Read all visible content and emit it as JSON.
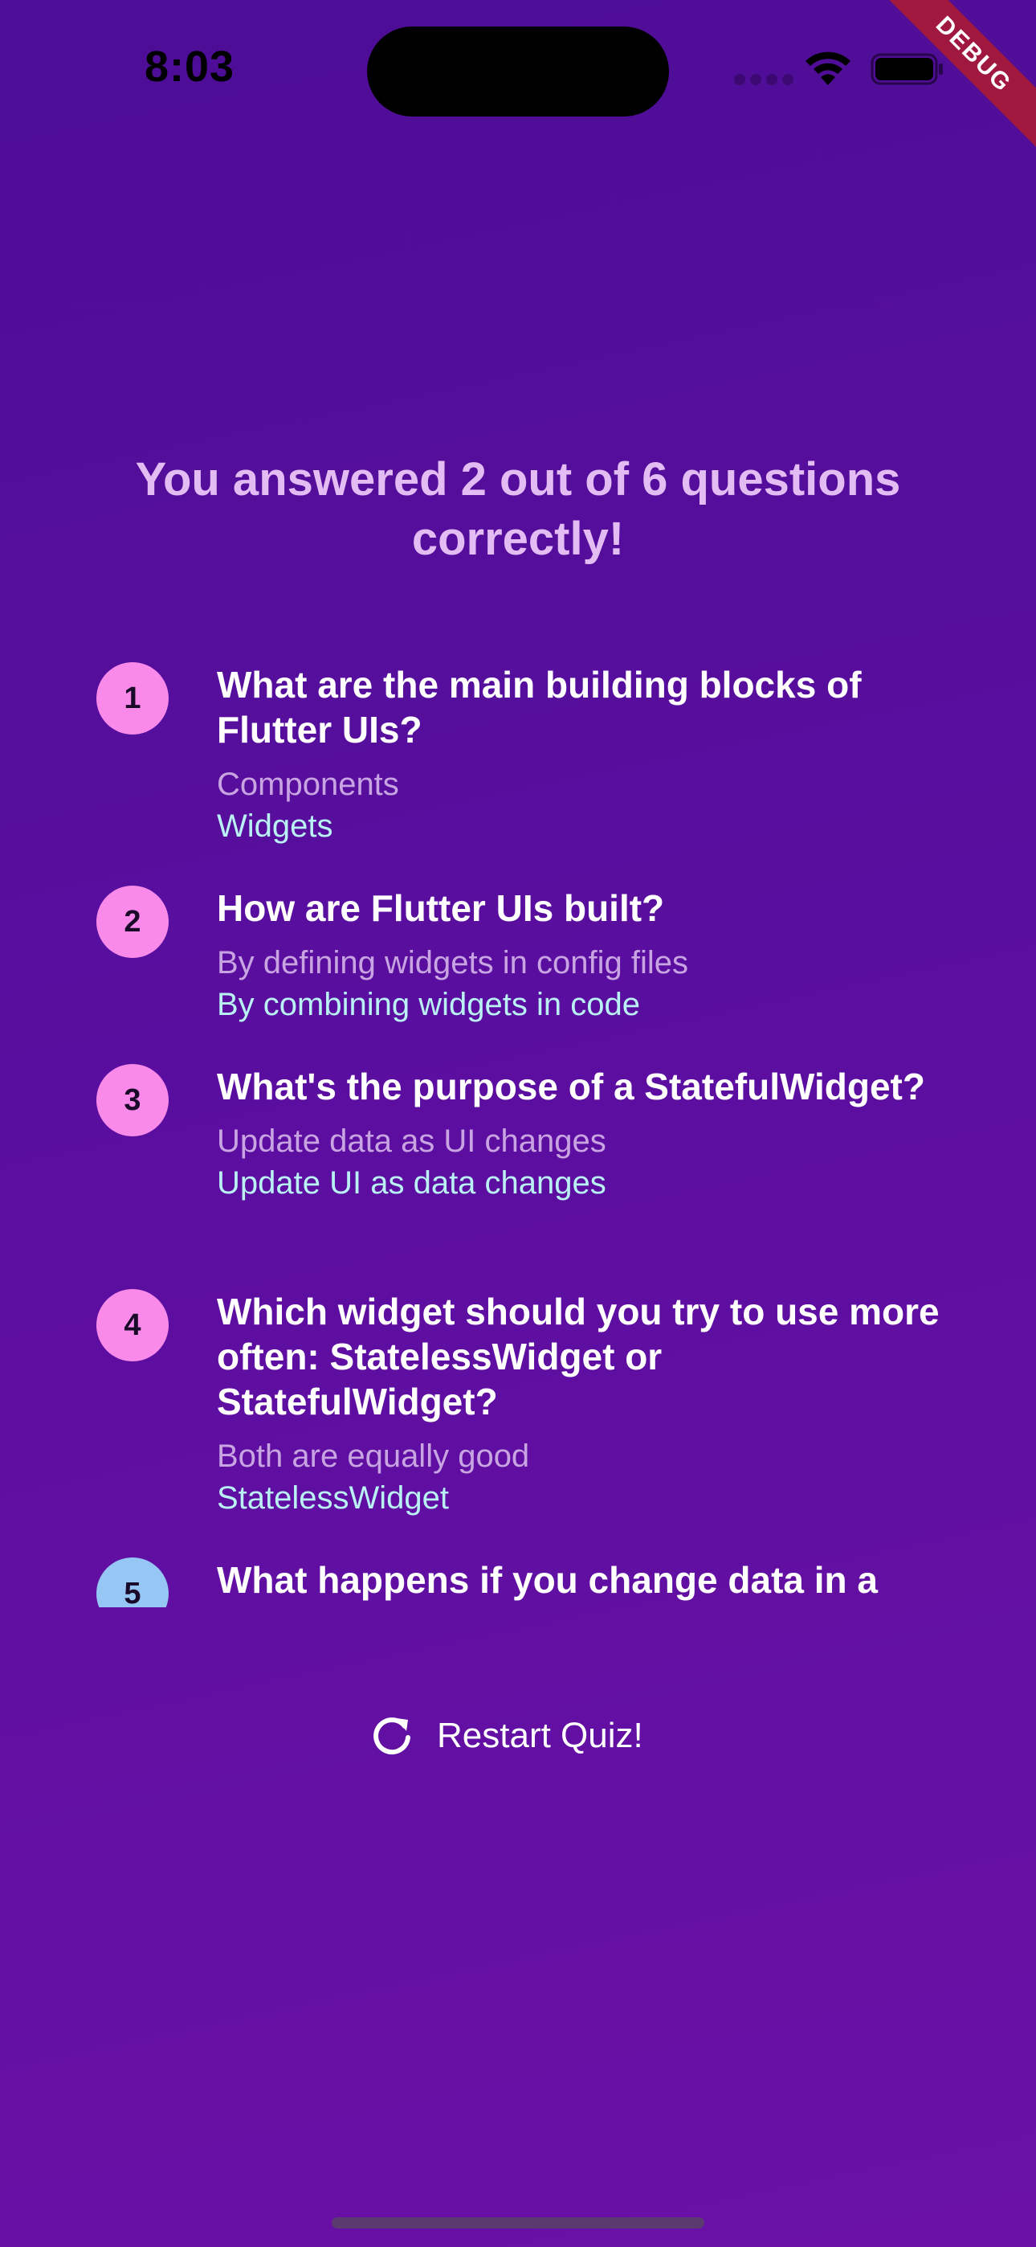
{
  "status_bar": {
    "time": "8:03",
    "icons": [
      "cellular-icon",
      "wifi-icon",
      "battery-icon"
    ]
  },
  "debug_banner": {
    "label": "DEBUG"
  },
  "results": {
    "title": "You answered 2 out of 6 questions correctly!",
    "items": [
      {
        "index": "1",
        "question": "What are the main building blocks of Flutter UIs?",
        "user_answer": "Components",
        "correct_answer": "Widgets",
        "is_correct": false
      },
      {
        "index": "2",
        "question": "How are Flutter UIs built?",
        "user_answer": "By defining widgets in config files",
        "correct_answer": "By combining widgets in code",
        "is_correct": false
      },
      {
        "index": "3",
        "question": "What's the purpose of a StatefulWidget?",
        "user_answer": "Update data as UI changes",
        "correct_answer": "Update UI as data changes",
        "is_correct": false
      },
      {
        "index": "4",
        "question": "Which widget should you try to use more often: StatelessWidget or StatefulWidget?",
        "user_answer": "Both are equally good",
        "correct_answer": "StatelessWidget",
        "is_correct": false
      },
      {
        "index": "5",
        "question": "What happens if you change data in a",
        "is_correct": true
      }
    ]
  },
  "restart": {
    "label": "Restart Quiz!",
    "icon": "refresh-icon"
  },
  "colors": {
    "background_top": "#4d0d96",
    "background_bottom": "#6a10a6",
    "title": "#e3bcf4",
    "wrong_index_bg": "#f98ae9",
    "correct_index_bg": "#96c7f4",
    "user_answer": "#c9a4e2",
    "correct_answer": "#b9f1f4",
    "debug_banner": "#a0183f"
  }
}
